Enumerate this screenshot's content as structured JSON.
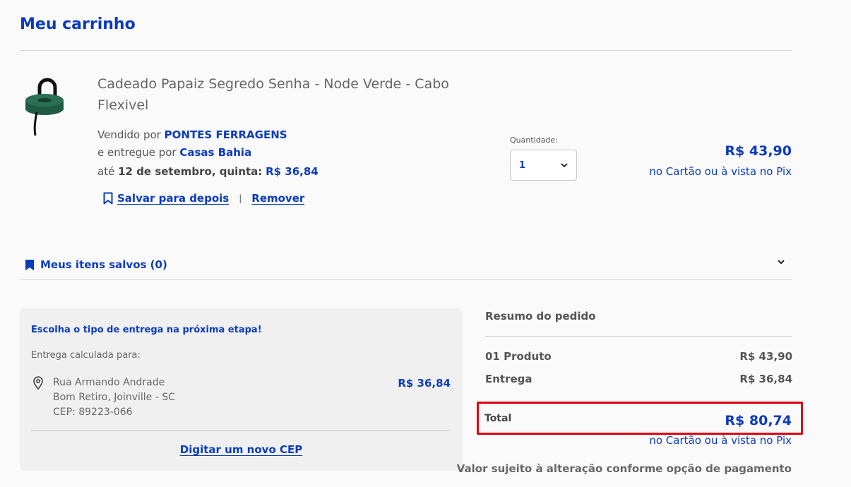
{
  "page": {
    "title": "Meu carrinho"
  },
  "product": {
    "name": "Cadeado Papaiz Segredo Senha - Node Verde - Cabo Flexivel",
    "sold_by_prefix": "Vendido por",
    "seller": "PONTES FERRAGENS",
    "delivered_by_prefix": "e entregue por",
    "deliverer": "Casas Bahia",
    "eta_prefix": "até",
    "eta_date": "12 de setembro, quinta:",
    "eta_price": "R$ 36,84",
    "save_label": "Salvar para depois",
    "separator": "|",
    "remove_label": "Remover",
    "quantity_label": "Quantidade:",
    "quantity_value": "1",
    "price": "R$ 43,90",
    "price_note": "no Cartão ou à vista no Pix",
    "image_color": "#1f5a44"
  },
  "saved_items": {
    "label": "Meus itens salvos (0)"
  },
  "delivery": {
    "heading": "Escolha o tipo de entrega na próxima etapa!",
    "calc_label": "Entrega calculada para:",
    "address_line1": "Rua Armando Andrade",
    "address_line2": "Bom Retiro, Joinville - SC",
    "address_line3": "CEP: 89223-066",
    "price": "R$ 36,84",
    "new_cep_label": "Digitar um novo CEP"
  },
  "summary": {
    "title": "Resumo do pedido",
    "products_label": "01 Produto",
    "products_value": "R$ 43,90",
    "shipping_label": "Entrega",
    "shipping_value": "R$ 36,84",
    "total_label": "Total",
    "total_value": "R$ 80,74",
    "total_note": "no Cartão ou à vista no Pix",
    "disclaimer": "Valor sujeito à alteração conforme opção de pagamento"
  },
  "colors": {
    "brand": "#0a3bbd",
    "highlight": "#e0000f"
  }
}
